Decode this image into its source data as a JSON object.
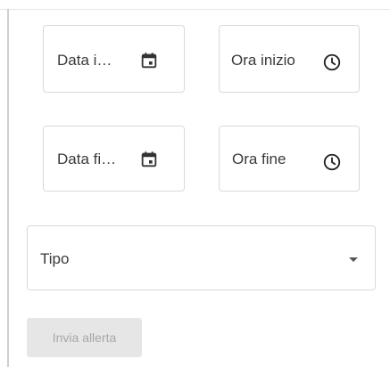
{
  "form": {
    "start_date": {
      "label": "Data i…",
      "icon": "calendar-icon"
    },
    "start_time": {
      "label": "Ora inizio",
      "icon": "clock-icon"
    },
    "end_date": {
      "label": "Data fi…",
      "icon": "calendar-icon"
    },
    "end_time": {
      "label": "Ora fine",
      "icon": "clock-icon"
    },
    "type_select": {
      "label": "Tipo",
      "icon": "dropdown-arrow-icon"
    },
    "submit_label": "Invia allerta"
  },
  "colors": {
    "border": "#d9d9d9",
    "disabled_bg": "#e6e6e6",
    "disabled_text": "#a8a8a8"
  }
}
